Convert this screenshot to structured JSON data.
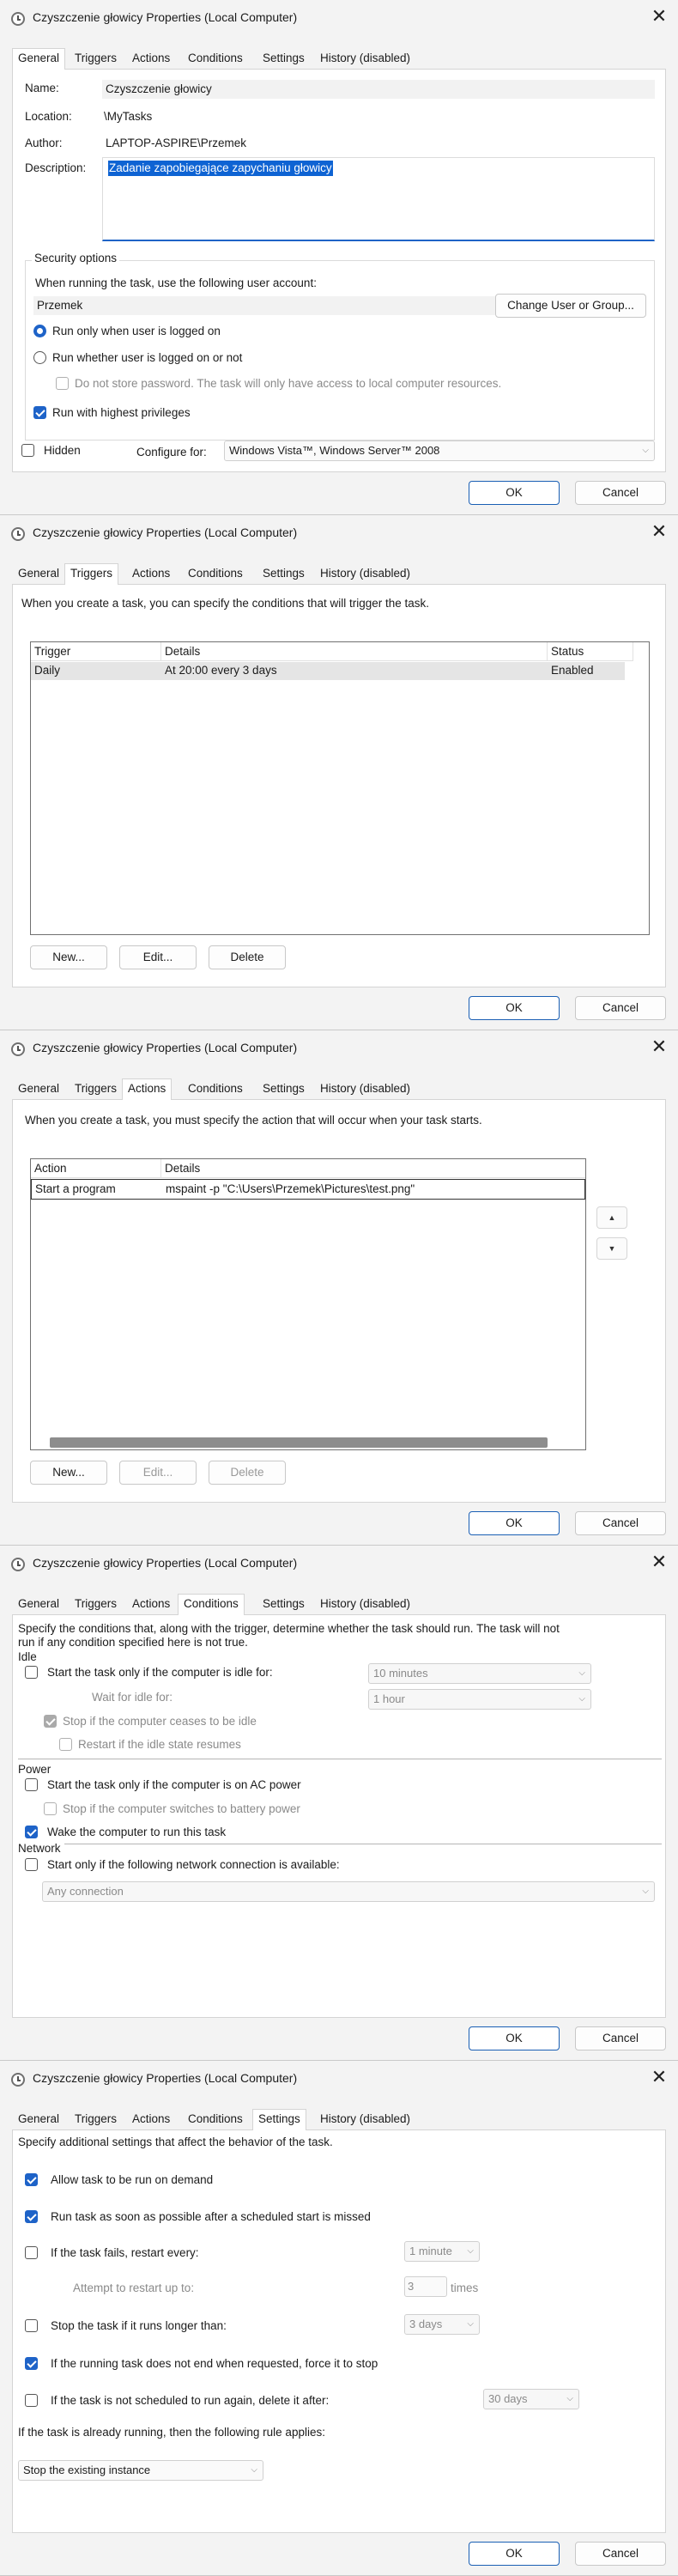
{
  "window": {
    "title": "Czyszczenie głowicy Properties (Local Computer)",
    "close_glyph": "✕"
  },
  "tabs": [
    "General",
    "Triggers",
    "Actions",
    "Conditions",
    "Settings",
    "History (disabled)"
  ],
  "buttons": {
    "ok": "OK",
    "cancel": "Cancel"
  },
  "general": {
    "name_label": "Name:",
    "name_value": "Czyszczenie głowicy",
    "location_label": "Location:",
    "location_value": "\\MyTasks",
    "author_label": "Author:",
    "author_value": "LAPTOP-ASPIRE\\Przemek",
    "description_label": "Description:",
    "description_value": "Zadanie zapobiegające zapychaniu głowicy",
    "security_title": "Security options",
    "run_as_label": "When running the task, use the following user account:",
    "user_account": "Przemek",
    "change_user_button": "Change User or Group...",
    "radio_logged_on": "Run only when user is logged on",
    "radio_whether": "Run whether user is logged on or not",
    "no_store_password": "Do not store password.  The task will only have access to local computer resources.",
    "highest_privileges": "Run with highest privileges",
    "hidden_label": "Hidden",
    "configure_for_label": "Configure for:",
    "configure_for_value": "Windows Vista™, Windows Server™ 2008"
  },
  "triggers": {
    "intro": "When you create a task, you can specify the conditions that will trigger the task.",
    "columns": [
      "Trigger",
      "Details",
      "Status"
    ],
    "rows": [
      {
        "trigger": "Daily",
        "details": "At 20:00 every 3 days",
        "status": "Enabled"
      }
    ],
    "new_button": "New...",
    "edit_button": "Edit...",
    "delete_button": "Delete"
  },
  "actions": {
    "intro": "When you create a task, you must specify the action that will occur when your task starts.",
    "columns": [
      "Action",
      "Details"
    ],
    "rows": [
      {
        "action": "Start a program",
        "details": "mspaint -p \"C:\\Users\\Przemek\\Pictures\\test.png\""
      }
    ],
    "up_glyph": "▲",
    "down_glyph": "▼",
    "new_button": "New...",
    "edit_button": "Edit...",
    "delete_button": "Delete"
  },
  "conditions": {
    "intro_line1": "Specify the conditions that, along with the trigger, determine whether the task should run.  The task will not",
    "intro_line2": "run  if any condition specified here is not true.",
    "idle_header": "Idle",
    "idle_start": "Start the task only if the computer is idle for:",
    "idle_duration": "10 minutes",
    "wait_label": "Wait for idle for:",
    "wait_value": "1 hour",
    "stop_idle": "Stop if the computer ceases to be idle",
    "restart_idle": "Restart if the idle state resumes",
    "power_header": "Power",
    "ac_power": "Start the task only if the computer is on AC power",
    "battery_stop": "Stop if the computer switches to battery power",
    "wake": "Wake the computer to run this task",
    "network_header": "Network",
    "network_start": "Start only if the following network connection is available:",
    "network_value": "Any connection"
  },
  "settings": {
    "intro": "Specify additional settings that affect the behavior of the task.",
    "allow_demand": "Allow task to be run on demand",
    "run_asap": "Run task as soon as possible after a scheduled start is missed",
    "restart_every": "If the task fails, restart every:",
    "restart_interval": "1 minute",
    "attempt_label": "Attempt to restart up to:",
    "attempt_value": "3",
    "times_label": "times",
    "stop_longer": "Stop the task if it runs longer than:",
    "stop_duration": "3 days",
    "force_stop": "If the running task does not end when requested, force it to stop",
    "delete_after": "If the task is not scheduled to run again, delete it after:",
    "delete_duration": "30 days",
    "rule_label": "If the task is already running, then the following rule applies:",
    "rule_value": "Stop the existing instance"
  }
}
